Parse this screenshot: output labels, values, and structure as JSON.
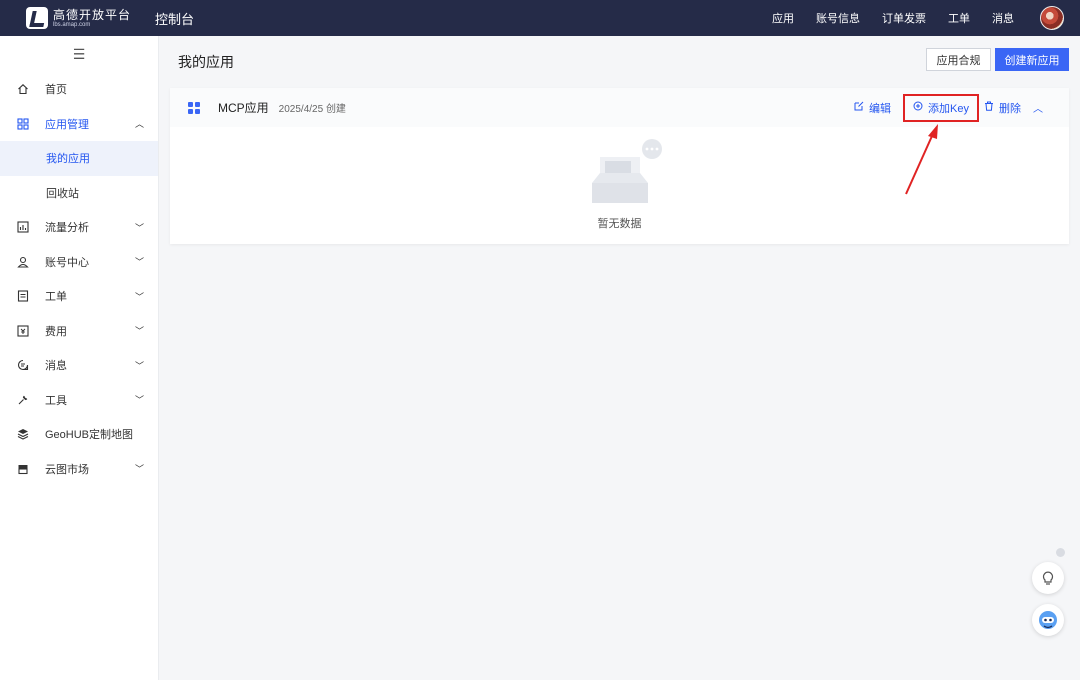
{
  "header": {
    "logo_name": "高德开放平台",
    "logo_sub": "lbs.amap.com",
    "console": "控制台",
    "nav": [
      "应用",
      "账号信息",
      "订单发票",
      "工单",
      "消息"
    ]
  },
  "sidebar": {
    "items": [
      {
        "label": "首页",
        "icon": "home-icon"
      },
      {
        "label": "应用管理",
        "icon": "grid-icon",
        "expanded": true,
        "children": [
          {
            "label": "我的应用",
            "active": true
          },
          {
            "label": "回收站"
          }
        ]
      },
      {
        "label": "流量分析",
        "icon": "chart-icon"
      },
      {
        "label": "账号中心",
        "icon": "user-icon"
      },
      {
        "label": "工单",
        "icon": "ticket-icon"
      },
      {
        "label": "费用",
        "icon": "fee-icon"
      },
      {
        "label": "消息",
        "icon": "message-icon"
      },
      {
        "label": "工具",
        "icon": "wrench-icon"
      },
      {
        "label": "GeoHUB定制地图",
        "icon": "layers-icon"
      },
      {
        "label": "云图市场",
        "icon": "store-icon"
      }
    ]
  },
  "main": {
    "title": "我的应用",
    "btn_compliance": "应用合规",
    "btn_create": "创建新应用",
    "app": {
      "name": "MCP应用",
      "created": "2025/4/25 创建",
      "edit": "编辑",
      "add_key": "添加Key",
      "delete": "删除"
    },
    "empty_text": "暂无数据"
  },
  "colors": {
    "topbar": "#252b48",
    "accent": "#2456f0",
    "highlight": "#e02323"
  }
}
